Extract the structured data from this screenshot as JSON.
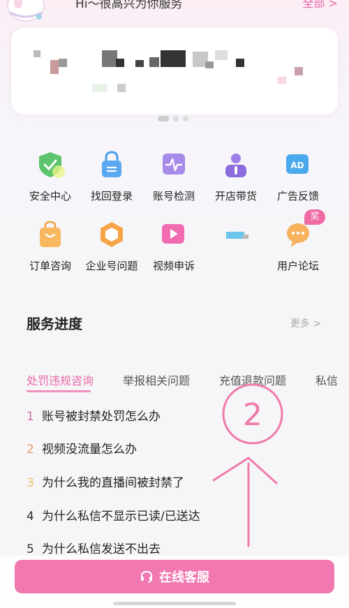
{
  "header": {
    "greeting": "Hi～很高兴为你服务",
    "all_link": "全部 >"
  },
  "services": [
    {
      "label": "安全中心",
      "icon": "shield-check-icon"
    },
    {
      "label": "找回登录",
      "icon": "lock-icon"
    },
    {
      "label": "账号检测",
      "icon": "pulse-monitor-icon"
    },
    {
      "label": "开店带货",
      "icon": "person-badge-icon"
    },
    {
      "label": "广告反馈",
      "icon": "ad-icon"
    },
    {
      "label": "订单咨询",
      "icon": "shopping-bag-icon"
    },
    {
      "label": "企业号问题",
      "icon": "enterprise-logo-icon"
    },
    {
      "label": "视频申诉",
      "icon": "play-icon"
    },
    {
      "label": "",
      "icon": "blurred-icon"
    },
    {
      "label": "用户论坛",
      "icon": "chat-bubble-icon",
      "badge": "奖"
    }
  ],
  "progress": {
    "title": "服务进度",
    "more_label": "更多 >"
  },
  "tabs": [
    {
      "label": "处罚违规咨询",
      "active": true
    },
    {
      "label": "举报相关问题",
      "active": false
    },
    {
      "label": "充值退款问题",
      "active": false
    },
    {
      "label": "私信",
      "active": false
    }
  ],
  "faq": [
    {
      "num": "1",
      "text": "账号被封禁处罚怎么办",
      "num_color": "#d86aa8"
    },
    {
      "num": "2",
      "text": "视频没流量怎么办",
      "num_color": "#e89a6a"
    },
    {
      "num": "3",
      "text": "为什么我的直播间被封禁了",
      "num_color": "#e8c36a"
    },
    {
      "num": "4",
      "text": "为什么私信不显示已读/已送达",
      "num_color": "#333333"
    },
    {
      "num": "5",
      "text": "为什么私信发送不出去",
      "num_color": "#333333"
    }
  ],
  "annotation": {
    "circled_text": "2"
  },
  "bottom": {
    "cs_button": "在线客服",
    "cs_icon": "headset-icon"
  },
  "colors": {
    "accent": "#e86aa6",
    "button": "#f178b0"
  }
}
